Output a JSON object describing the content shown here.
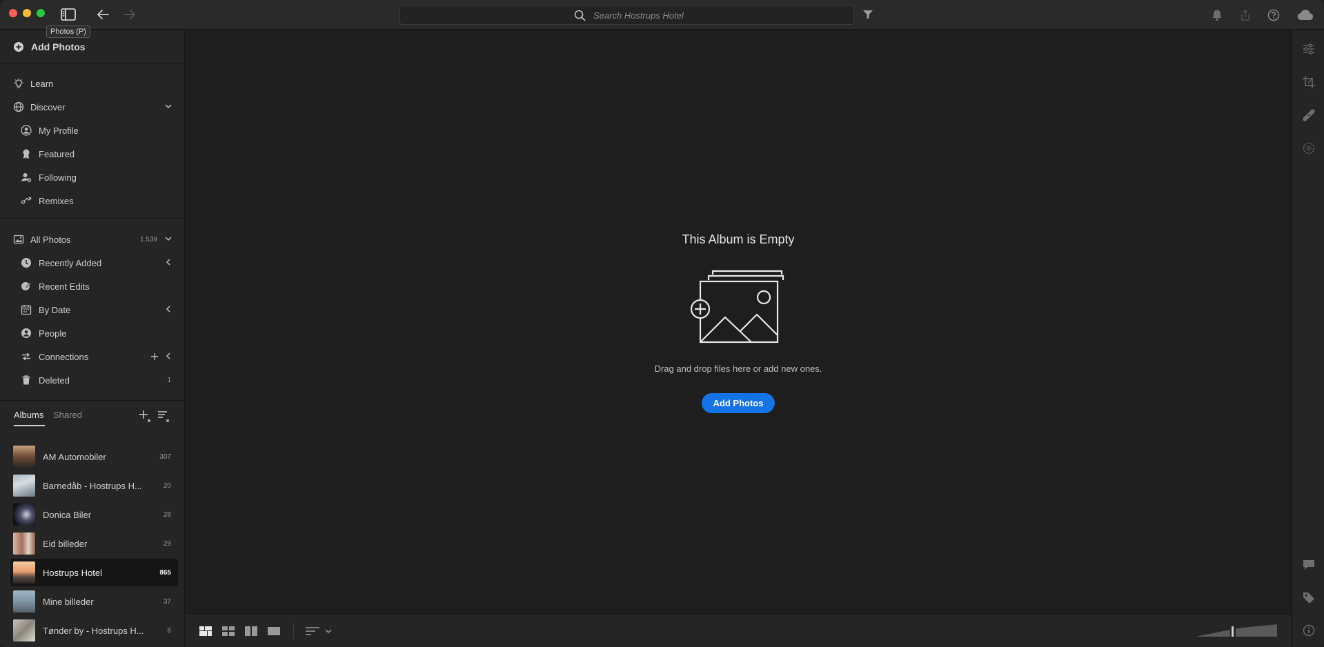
{
  "window": {
    "tooltip": "Photos (P)",
    "search": {
      "placeholder": "Search Hostrups Hotel"
    }
  },
  "sidebar": {
    "add_photos": "Add Photos",
    "learn": "Learn",
    "discover": "Discover",
    "discover_items": [
      "My Profile",
      "Featured",
      "Following",
      "Remixes"
    ],
    "all_photos": {
      "label": "All Photos",
      "count": "1.539"
    },
    "library_items": [
      {
        "label": "Recently Added",
        "count": ""
      },
      {
        "label": "Recent Edits",
        "count": ""
      },
      {
        "label": "By Date",
        "count": ""
      },
      {
        "label": "People",
        "count": ""
      },
      {
        "label": "Connections",
        "count": ""
      },
      {
        "label": "Deleted",
        "count": "1"
      }
    ],
    "tabs": {
      "albums": "Albums",
      "shared": "Shared"
    },
    "albums": [
      {
        "label": "AM Automobiler",
        "count": "307"
      },
      {
        "label": "Barnedåb - Hostrups H...",
        "count": "20"
      },
      {
        "label": "Donica Biler",
        "count": "28"
      },
      {
        "label": "Eid billeder",
        "count": "29"
      },
      {
        "label": "Hostrups Hotel",
        "count": "865"
      },
      {
        "label": "Mine billeder",
        "count": "37"
      },
      {
        "label": "Tønder by - Hostrups H...",
        "count": "6"
      }
    ]
  },
  "main": {
    "empty_title": "This Album is Empty",
    "empty_desc": "Drag and drop files here or add new ones.",
    "add_button": "Add Photos"
  },
  "colors": {
    "accent": "#1473e6",
    "background": "#1e1e1e",
    "panel": "#252525"
  }
}
